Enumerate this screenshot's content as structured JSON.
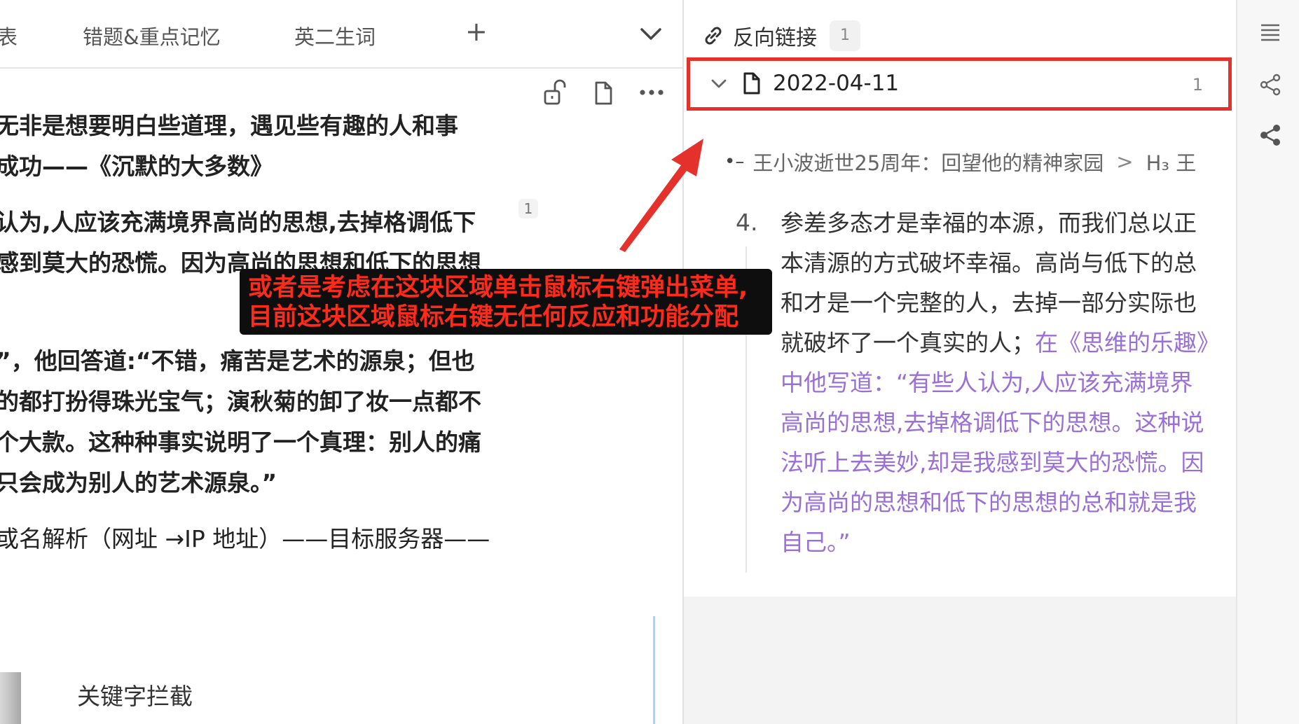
{
  "left": {
    "tabs": {
      "partial": "表",
      "tab1": "错题&重点记忆",
      "tab2": "英二生词",
      "add": "+"
    },
    "toolbar_icons": [
      "unlock-icon",
      "file-icon",
      "more-icon"
    ],
    "lines": {
      "l1": "无非是想要明白些道理，遇见些有趣的人和事",
      "l2": "成功——《沉默的大多数》",
      "l3": "认为,人应该充满境界高尚的思想,去掉格调低下",
      "l4": "感到莫大的恐慌。因为高尚的思想和低下的思想",
      "l5": "”，他回答道:“不错，痛苦是艺术的源泉；但也",
      "l6": "的都打扮得珠光宝气；演秋菊的卸了妆一点都不",
      "l7": "个大款。这种种事实说明了一个真理：别人的痛",
      "l8": "只会成为别人的艺术源泉。”",
      "l9": "或名解析（网址 →IP 地址）——目标服务器——"
    },
    "footnote": "1",
    "keyword": "关键字拦截"
  },
  "backlinks": {
    "title": "反向链接",
    "count": "1",
    "date": "2022-04-11",
    "date_count": "1",
    "breadcrumb": {
      "doc": "王小波逝世25周年：回望他的精神家园",
      "sep": ">",
      "heading": "H₃ 王"
    },
    "item_number": "4.",
    "paragraph": {
      "plain": "参差多态才是幸福的本源，而我们总以正本清源的方式破坏幸福。高尚与低下的总和才是一个完整的人，去掉一部分实际也就破坏了一个真实的人；",
      "link": "在《思维的乐趣》中他写道：“有些人认为,人应该充满境界高尚的思想,去掉格调低下的思想。这种说法听上去美妙,却是我感到莫大的恐慌。因为高尚的思想和低下的思想的总和就是我自己。”"
    }
  },
  "rail_icons": [
    "list-icon",
    "graph-icon",
    "share-graph-icon"
  ],
  "annotation": {
    "line1": "或者是考虑在这块区域单击鼠标右键弹出菜单,",
    "line2": "目前这块区域鼠标右键无任何反应和功能分配"
  },
  "colors": {
    "highlight_border": "#e5312c",
    "annotation_text": "#ff2a1a",
    "link_text": "#9a6fd6"
  }
}
